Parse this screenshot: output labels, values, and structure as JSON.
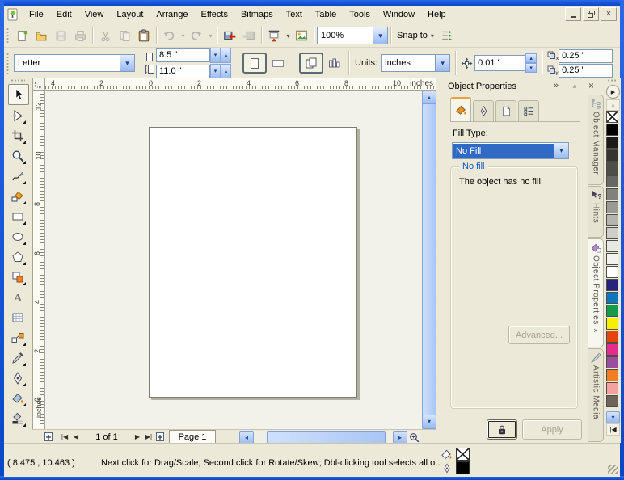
{
  "menu": {
    "items": [
      "File",
      "Edit",
      "View",
      "Layout",
      "Arrange",
      "Effects",
      "Bitmaps",
      "Text",
      "Table",
      "Tools",
      "Window",
      "Help"
    ]
  },
  "window_controls": {
    "icons": [
      "minimize",
      "restore",
      "close"
    ]
  },
  "toolbar": {
    "zoom_value": "100%",
    "snap_label": "Snap to",
    "icons": [
      "new",
      "open",
      "save",
      "print",
      "cut",
      "copy",
      "paste",
      "undo",
      "redo",
      "import",
      "export",
      "application-launcher",
      "welcome-screen",
      "zoom-levels",
      "snap-to",
      "options"
    ]
  },
  "property_bar": {
    "paper_type": "Letter",
    "paper_width": "8.5 \"",
    "paper_height": "11.0 \"",
    "units_label": "Units:",
    "units_value": "inches",
    "nudge_offset": "0.01 \"",
    "duplicate_x": "0.25 \"",
    "duplicate_y": "0.25 \""
  },
  "rulers": {
    "unit_label": "inches",
    "h_ticks": [
      "4",
      "2",
      "0",
      "2",
      "4",
      "6",
      "8",
      "10"
    ],
    "v_ticks": [
      "12",
      "10",
      "8",
      "6",
      "4",
      "2",
      "0"
    ]
  },
  "toolbox": {
    "tools": [
      "pick",
      "shape",
      "crop",
      "zoom",
      "freehand",
      "smart-fill",
      "rectangle",
      "ellipse",
      "polygon",
      "basic-shapes",
      "text",
      "table",
      "interactive-blend",
      "eyedropper",
      "outline-pen",
      "fill",
      "interactive-fill"
    ]
  },
  "docker": {
    "title": "Object Properties",
    "tabs": [
      "fill",
      "outline",
      "page",
      "summary"
    ],
    "fill_type_label": "Fill Type:",
    "fill_type_value": "No Fill",
    "group_title": "No fill",
    "group_text": "The object has no fill.",
    "advanced_label": "Advanced...",
    "apply_label": "Apply",
    "vertical_tabs": [
      "Object Manager",
      "Hints",
      "Object Properties",
      "Artistic Media"
    ]
  },
  "palette": {
    "no_color_label": "no-color",
    "colors": [
      "#000000",
      "#1b1b19",
      "#343431",
      "#4e4e4a",
      "#676763",
      "#81817d",
      "#9a9a96",
      "#b4b4b0",
      "#cdcdc9",
      "#e7e7e3",
      "#f2f2ee",
      "#ffffff",
      "#26237d",
      "#0d76c3",
      "#129b49",
      "#f7ef00",
      "#e6440e",
      "#e52a90",
      "#9b4e9e",
      "#ef7f22",
      "#f3a2a1",
      "#6e665a"
    ]
  },
  "page_controls": {
    "page_count": "1 of 1",
    "page_tab": "Page 1"
  },
  "status_bar": {
    "coordinates": "( 8.475 , 10.463 )",
    "message": "Next click for Drag/Scale; Second click for Rotate/Skew; Dbl-clicking tool selects all o...",
    "fill_indicator": "no-fill",
    "outline_indicator": "#000000"
  }
}
